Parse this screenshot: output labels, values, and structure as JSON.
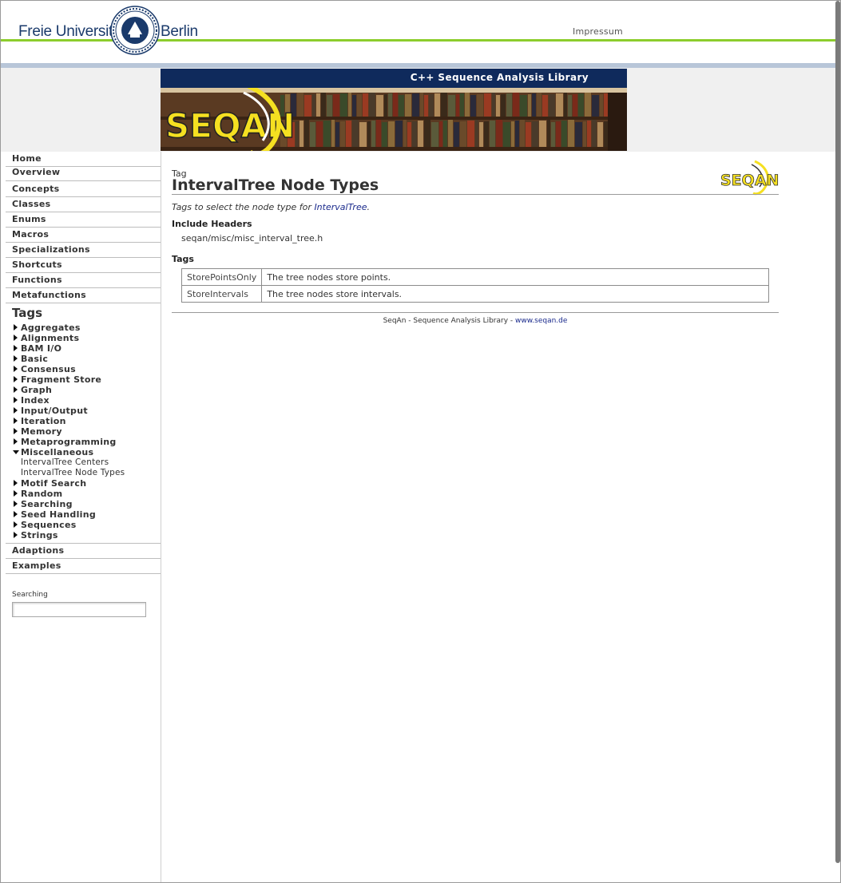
{
  "header": {
    "org_left": "Freie Universität",
    "org_right": "Berlin",
    "impressum": "Impressum"
  },
  "banner": {
    "title": "C++ Sequence Analysis Library",
    "logo_text": "SEQAN"
  },
  "nav": {
    "items_top": [
      "Home",
      "Overview",
      "Concepts",
      "Classes",
      "Enums",
      "Macros",
      "Specializations",
      "Shortcuts",
      "Functions",
      "Metafunctions"
    ],
    "tags_heading": "Tags",
    "tag_groups": [
      {
        "label": "Aggregates",
        "open": false
      },
      {
        "label": "Alignments",
        "open": false
      },
      {
        "label": "BAM I/O",
        "open": false
      },
      {
        "label": "Basic",
        "open": false
      },
      {
        "label": "Consensus",
        "open": false
      },
      {
        "label": "Fragment Store",
        "open": false
      },
      {
        "label": "Graph",
        "open": false
      },
      {
        "label": "Index",
        "open": false
      },
      {
        "label": "Input/Output",
        "open": false
      },
      {
        "label": "Iteration",
        "open": false
      },
      {
        "label": "Memory",
        "open": false
      },
      {
        "label": "Metaprogramming",
        "open": false
      },
      {
        "label": "Miscellaneous",
        "open": true
      },
      {
        "label": "Motif Search",
        "open": false
      },
      {
        "label": "Random",
        "open": false
      },
      {
        "label": "Searching",
        "open": false
      },
      {
        "label": "Seed Handling",
        "open": false
      },
      {
        "label": "Sequences",
        "open": false
      },
      {
        "label": "Strings",
        "open": false
      }
    ],
    "misc_children": [
      "IntervalTree Centers",
      "IntervalTree Node Types"
    ],
    "items_bottom": [
      "Adaptions",
      "Examples"
    ],
    "search_label": "Searching",
    "search_value": ""
  },
  "main": {
    "kind": "Tag",
    "title": "IntervalTree Node Types",
    "summary_prefix": "Tags to select the node type for ",
    "summary_link": "IntervalTree",
    "summary_suffix": ".",
    "include_heading": "Include Headers",
    "include_file": "seqan/misc/misc_interval_tree.h",
    "tags_heading": "Tags",
    "tags": [
      {
        "name": "StorePointsOnly",
        "desc": "The tree nodes store points."
      },
      {
        "name": "StoreIntervals",
        "desc": "The tree nodes store intervals."
      }
    ]
  },
  "footer": {
    "text": "SeqAn - Sequence Analysis Library - ",
    "link": "www.seqan.de"
  },
  "colors": {
    "fu_blue": "#1a3a6b",
    "fu_green": "#8ccd2c",
    "banner_navy": "#0f2a5c",
    "seqan_yellow": "#f5e021",
    "link_blue": "#1a2a8c"
  }
}
